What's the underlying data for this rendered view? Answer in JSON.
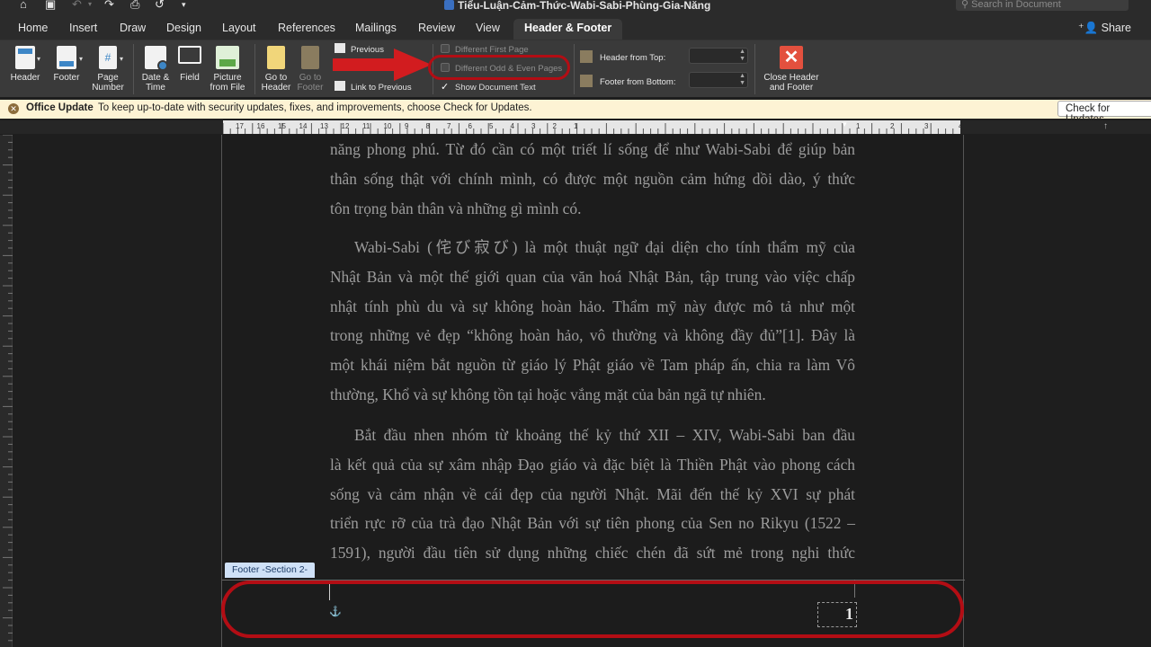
{
  "window": {
    "title": "Tiểu-Luận-Cảm-Thức-Wabi-Sabi-Phùng-Gia-Năng"
  },
  "search": {
    "placeholder": "Search in Document"
  },
  "tabs": [
    {
      "label": "Home"
    },
    {
      "label": "Insert"
    },
    {
      "label": "Draw"
    },
    {
      "label": "Design"
    },
    {
      "label": "Layout"
    },
    {
      "label": "References"
    },
    {
      "label": "Mailings"
    },
    {
      "label": "Review"
    },
    {
      "label": "View"
    },
    {
      "label": "Header & Footer"
    }
  ],
  "share_label": "Share",
  "ribbon": {
    "header": "Header",
    "footer": "Footer",
    "page_number_1": "Page",
    "page_number_2": "Number",
    "date_time_1": "Date &",
    "date_time_2": "Time",
    "field": "Field",
    "picture_1": "Picture",
    "picture_2": "from File",
    "go_header_1": "Go to",
    "go_header_2": "Header",
    "go_footer_1": "Go to",
    "go_footer_2": "Footer",
    "previous": "Previous",
    "link_previous": "Link to Previous",
    "different_first_page": "Different First Page",
    "different_odd_even": "Different Odd & Even Pages",
    "show_document_text": "Show Document Text",
    "header_from_top": "Header from Top:",
    "footer_from_bottom": "Footer from Bottom:",
    "close_1": "Close Header",
    "close_2": "and Footer"
  },
  "update_bar": {
    "title": "Office Update",
    "message": "To keep up-to-date with security updates, fixes, and improvements, choose Check for Updates.",
    "button": "Check for Updates"
  },
  "ruler": {
    "labels": [
      "17",
      "16",
      "15",
      "14",
      "13",
      "12",
      "11",
      "10",
      "9",
      "8",
      "7",
      "6",
      "5",
      "4",
      "3",
      "2",
      "1",
      "1",
      "2",
      "3",
      "4"
    ]
  },
  "document": {
    "paragraphs": [
      [
        "năng phong phú. Từ đó cần có một triết lí sống để như Wabi-Sabi để giúp bản",
        "thân sống thật với chính mình, có được một nguồn cảm hứng dồi dào, ý thức",
        "tôn trọng bản thân và những gì mình có."
      ],
      [
        "Wabi-Sabi (侘び寂び) là một thuật ngữ đại diện cho tính thẩm mỹ của",
        "Nhật Bản và một thế giới quan của văn hoá Nhật Bản, tập trung vào việc chấp",
        "nhật tính phù du và sự không hoàn hảo. Thẩm mỹ này được mô tả như một",
        "trong những vẻ đẹp “không hoàn hảo, vô thường và không đầy đủ”[1]. Đây là",
        "một khái niệm bắt nguồn từ giáo lý Phật giáo về Tam pháp ấn, chia ra làm Vô",
        "thường, Khổ và sự không tồn tại hoặc vắng mặt của bản ngã tự nhiên."
      ],
      [
        "Bắt đầu nhen nhóm từ khoảng thế kỷ thứ XII – XIV, Wabi-Sabi ban đầu",
        "là kết quả của sự xâm nhập Đạo giáo và đặc biệt là Thiền Phật vào phong cách",
        "sống và cảm nhận về cái đẹp của người Nhật. Mãi đến thế kỷ XVI sự phát",
        "triển rực rỡ của trà đạo Nhật Bản với sự tiên phong của Sen no Rikyu (1522 –",
        "1591), người đầu tiên sử dụng những chiếc chén đã sứt mẻ trong nghi thức"
      ]
    ],
    "footer_tag": "Footer -Section 2-",
    "page_number": "1"
  },
  "colors": {
    "annotation_red": "#b30d14",
    "update_bar": "#fdf3d4"
  }
}
